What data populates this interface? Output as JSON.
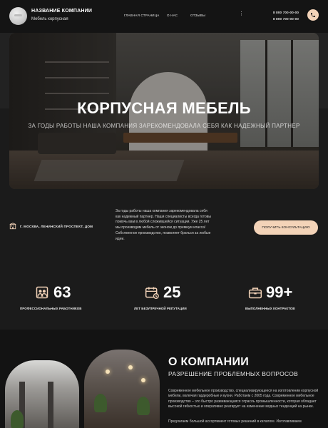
{
  "header": {
    "company_name": "НАЗВАНИЕ КОМПАНИИ",
    "company_sub": "Мебель корпусная",
    "nav": [
      "ГЛАВНАЯ СТРАНИЦА",
      "О НАС",
      "ОТЗЫВЫ"
    ],
    "nav_more": "⋮",
    "phones": [
      "8 800 700-00-00",
      "8 800 700-00-00"
    ],
    "call_icon": "phone-icon"
  },
  "hero": {
    "title": "КОРПУСНАЯ МЕБЕЛЬ",
    "subtitle": "ЗА ГОДЫ РАБОТЫ НАША КОМПАНИЯ ЗАРЕКОМЕНДОВАЛА СЕБЯ КАК НАДЕЖНЫЙ ПАРТНЕР"
  },
  "info": {
    "address": "Г. МОСКВА, ЛЕНИНСКИЙ ПРОСПЕКТ, ДОМ",
    "about": "За годы работы наша компания зарекомендовала себя как надежный партнер. Наши специалисты всегда готовы помочь вам в любой сложившейся ситуации. Уже 25 лет мы производим мебель от эконом до премиум класса! Собственное производство, позволяет браться за любые идеи.",
    "cta": "ПОЛУЧИТЬ КОНСУЛЬТАЦИЮ"
  },
  "stats": [
    {
      "number": "63",
      "label": "ПРОФЕССИОНАЛЬНЫХ РАБОТНИКОВ",
      "icon": "workers-icon"
    },
    {
      "number": "25",
      "label": "ЛЕТ БЕЗУПРЕЧНОЙ РЕПУТАЦИИ",
      "icon": "calendar-icon"
    },
    {
      "number": "99+",
      "label": "ВЫПОЛНЕННЫХ КОНТРАКТОВ",
      "icon": "contracts-icon"
    }
  ],
  "about_section": {
    "title": "О КОМПАНИИ",
    "subtitle": "РАЗРЕШЕНИЕ ПРОБЛЕМНЫХ ВОПРОСОВ",
    "p1": "Современное мебельное производство, специализирующееся на изготовлении корпусной мебели, включая гардеробные и кухни. Работаем с 2005 года. Современное мебельное производство – это быстро развивающаяся отрасль промышленности, которая обладает высокой гибкостью и оперативно реагирует на изменение модных тенденций на рынке.",
    "p2": "Предлагаем большой ассортимент готовых решений в каталоге. Изготавливаем"
  },
  "colors": {
    "accent": "#f3d3b8",
    "background": "#1b1b1b",
    "header_bg": "#141414"
  }
}
